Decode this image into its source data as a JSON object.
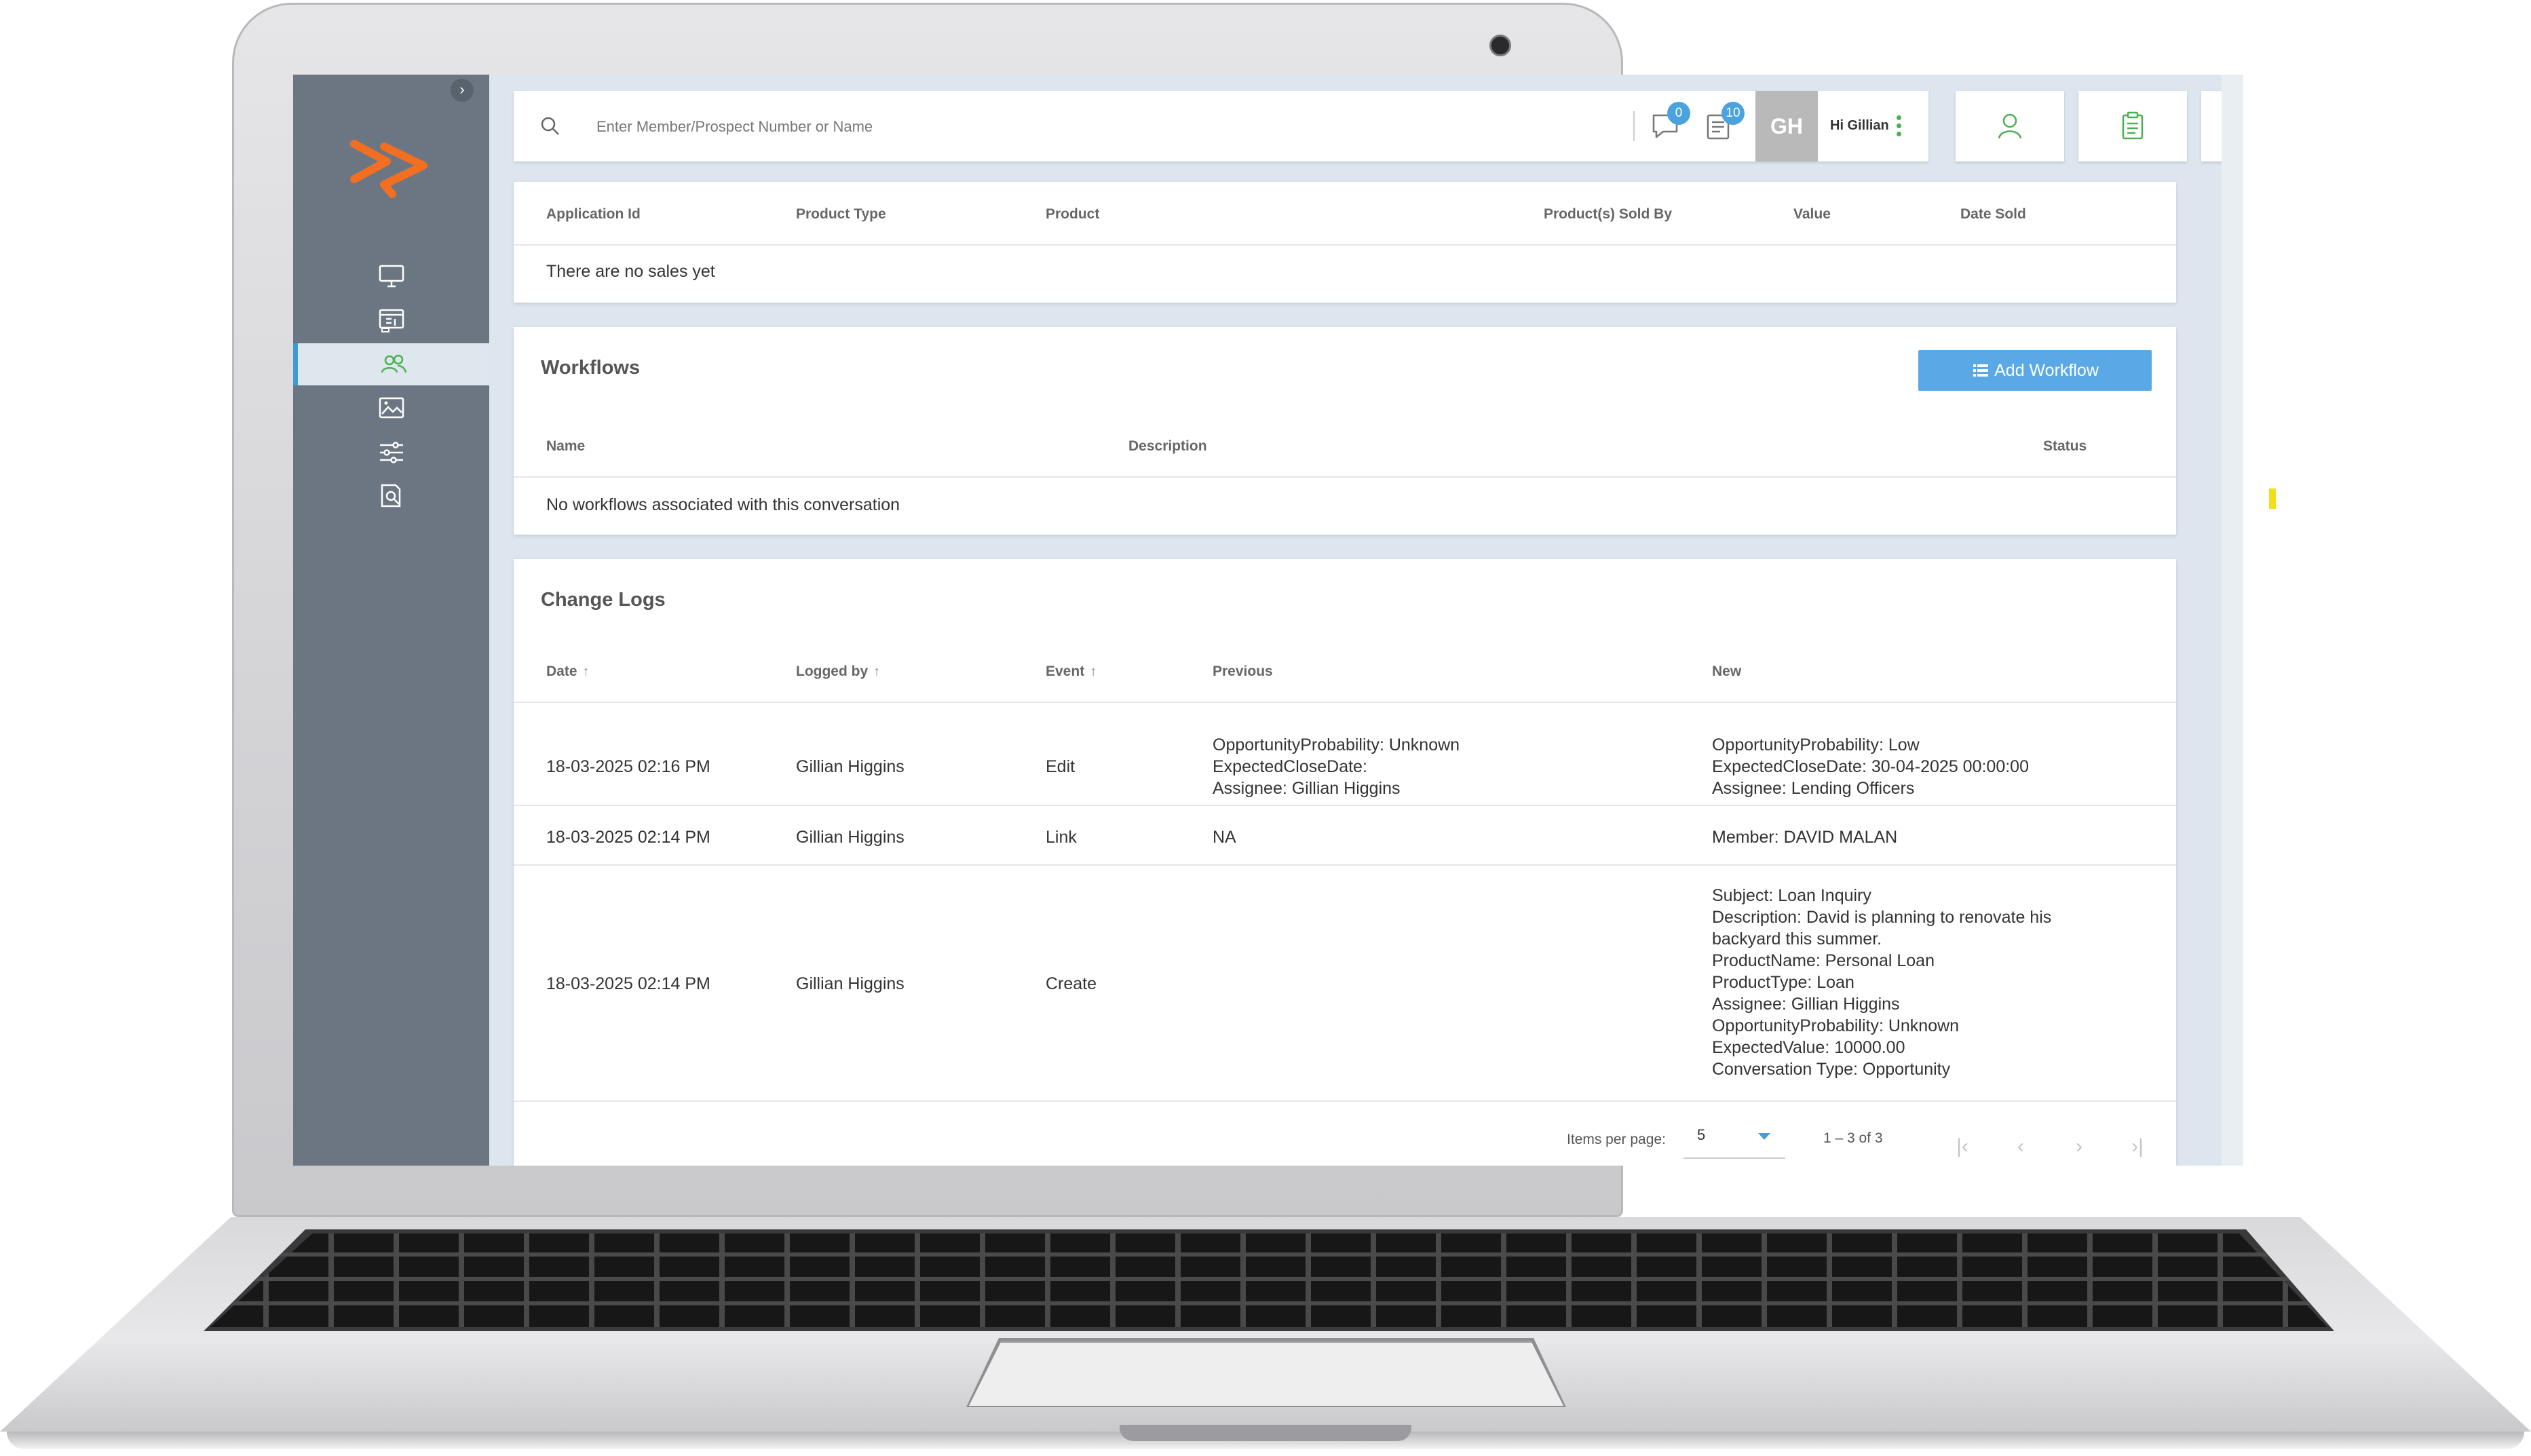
{
  "search": {
    "placeholder": "Enter Member/Prospect Number or Name"
  },
  "header": {
    "messages_badge": "0",
    "tasks_badge": "10",
    "avatar_initials": "GH",
    "greeting": "Hi Gillian"
  },
  "sales": {
    "columns": [
      "Application Id",
      "Product Type",
      "Product",
      "Product(s) Sold By",
      "Value",
      "Date Sold"
    ],
    "empty_text": "There are no sales yet"
  },
  "workflows": {
    "title": "Workflows",
    "add_button_label": "Add Workflow",
    "columns": [
      "Name",
      "Description",
      "Status"
    ],
    "empty_text": "No workflows associated with this conversation"
  },
  "change_logs": {
    "title": "Change Logs",
    "columns": [
      "Date",
      "Logged by",
      "Event",
      "Previous",
      "New"
    ],
    "rows": [
      {
        "date": "18-03-2025 02:16 PM",
        "logged_by": "Gillian Higgins",
        "event": "Edit",
        "previous": [
          "OpportunityProbability: Unknown",
          "ExpectedCloseDate:",
          "Assignee: Gillian Higgins"
        ],
        "new": [
          "OpportunityProbability: Low",
          "ExpectedCloseDate: 30-04-2025 00:00:00",
          "Assignee: Lending Officers"
        ]
      },
      {
        "date": "18-03-2025 02:14 PM",
        "logged_by": "Gillian Higgins",
        "event": "Link",
        "previous": [
          "NA"
        ],
        "new": [
          "Member: DAVID MALAN"
        ]
      },
      {
        "date": "18-03-2025 02:14 PM",
        "logged_by": "Gillian Higgins",
        "event": "Create",
        "previous": [],
        "new": [
          "Subject: Loan Inquiry",
          "Description: David is planning to renovate his",
          "backyard this summer.",
          "ProductName: Personal Loan",
          "ProductType: Loan",
          "Assignee: Gillian Higgins",
          "OpportunityProbability: Unknown",
          "ExpectedValue: 10000.00",
          "Conversation Type: Opportunity"
        ]
      }
    ],
    "pagination": {
      "items_per_page_label": "Items per page:",
      "items_per_page_value": "5",
      "range_text": "1 – 3 of 3"
    }
  },
  "colors": {
    "sidebar": "#6b7682",
    "accent_blue": "#5aa9e6",
    "accent_green": "#4caf50",
    "logo_orange": "#f26f21"
  },
  "icons": {
    "sidebar": [
      "monitor-icon",
      "dashboard-icon",
      "users-icon",
      "image-chart-icon",
      "sliders-icon",
      "document-search-icon"
    ],
    "topbar": [
      "search-icon",
      "chat-icon",
      "tasks-icon",
      "kebab-icon",
      "person-icon",
      "clipboard-icon"
    ]
  }
}
